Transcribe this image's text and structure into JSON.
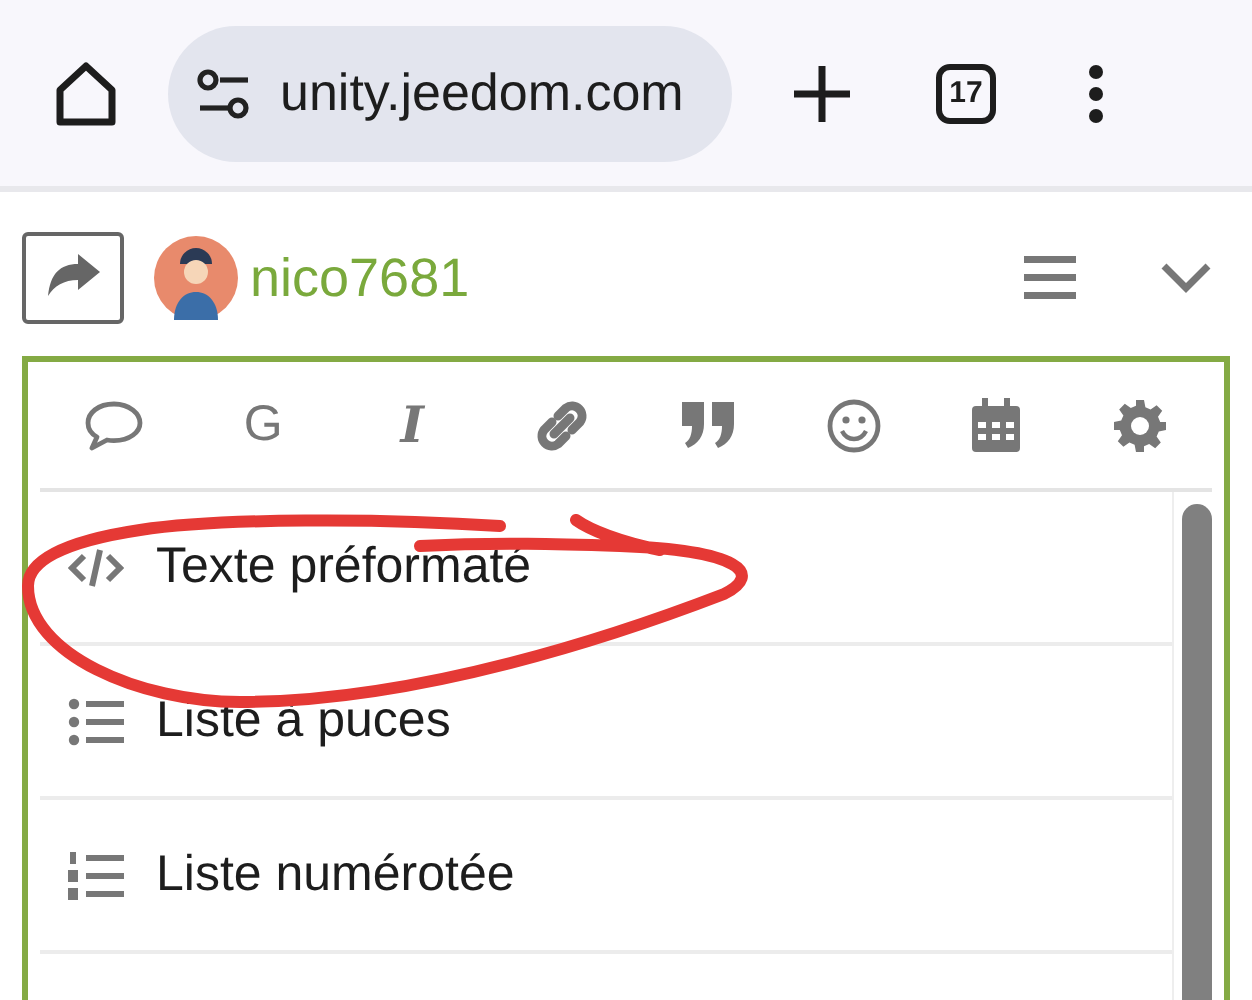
{
  "browser": {
    "url": "unity.jeedom.com",
    "tab_count": "17"
  },
  "post": {
    "username": "nico7681"
  },
  "toolbar": [
    {
      "kind": "bubble"
    },
    {
      "kind": "letter",
      "label": "G"
    },
    {
      "kind": "italic",
      "label": "I"
    },
    {
      "kind": "link"
    },
    {
      "kind": "quote"
    },
    {
      "kind": "smiley"
    },
    {
      "kind": "calendar"
    },
    {
      "kind": "gear"
    }
  ],
  "menu": [
    {
      "kind": "code",
      "label": "Texte préformaté"
    },
    {
      "kind": "bullets",
      "label": "Liste à puces"
    },
    {
      "kind": "numbers",
      "label": "Liste numérotée"
    }
  ],
  "annotation": {
    "kind": "circle"
  }
}
